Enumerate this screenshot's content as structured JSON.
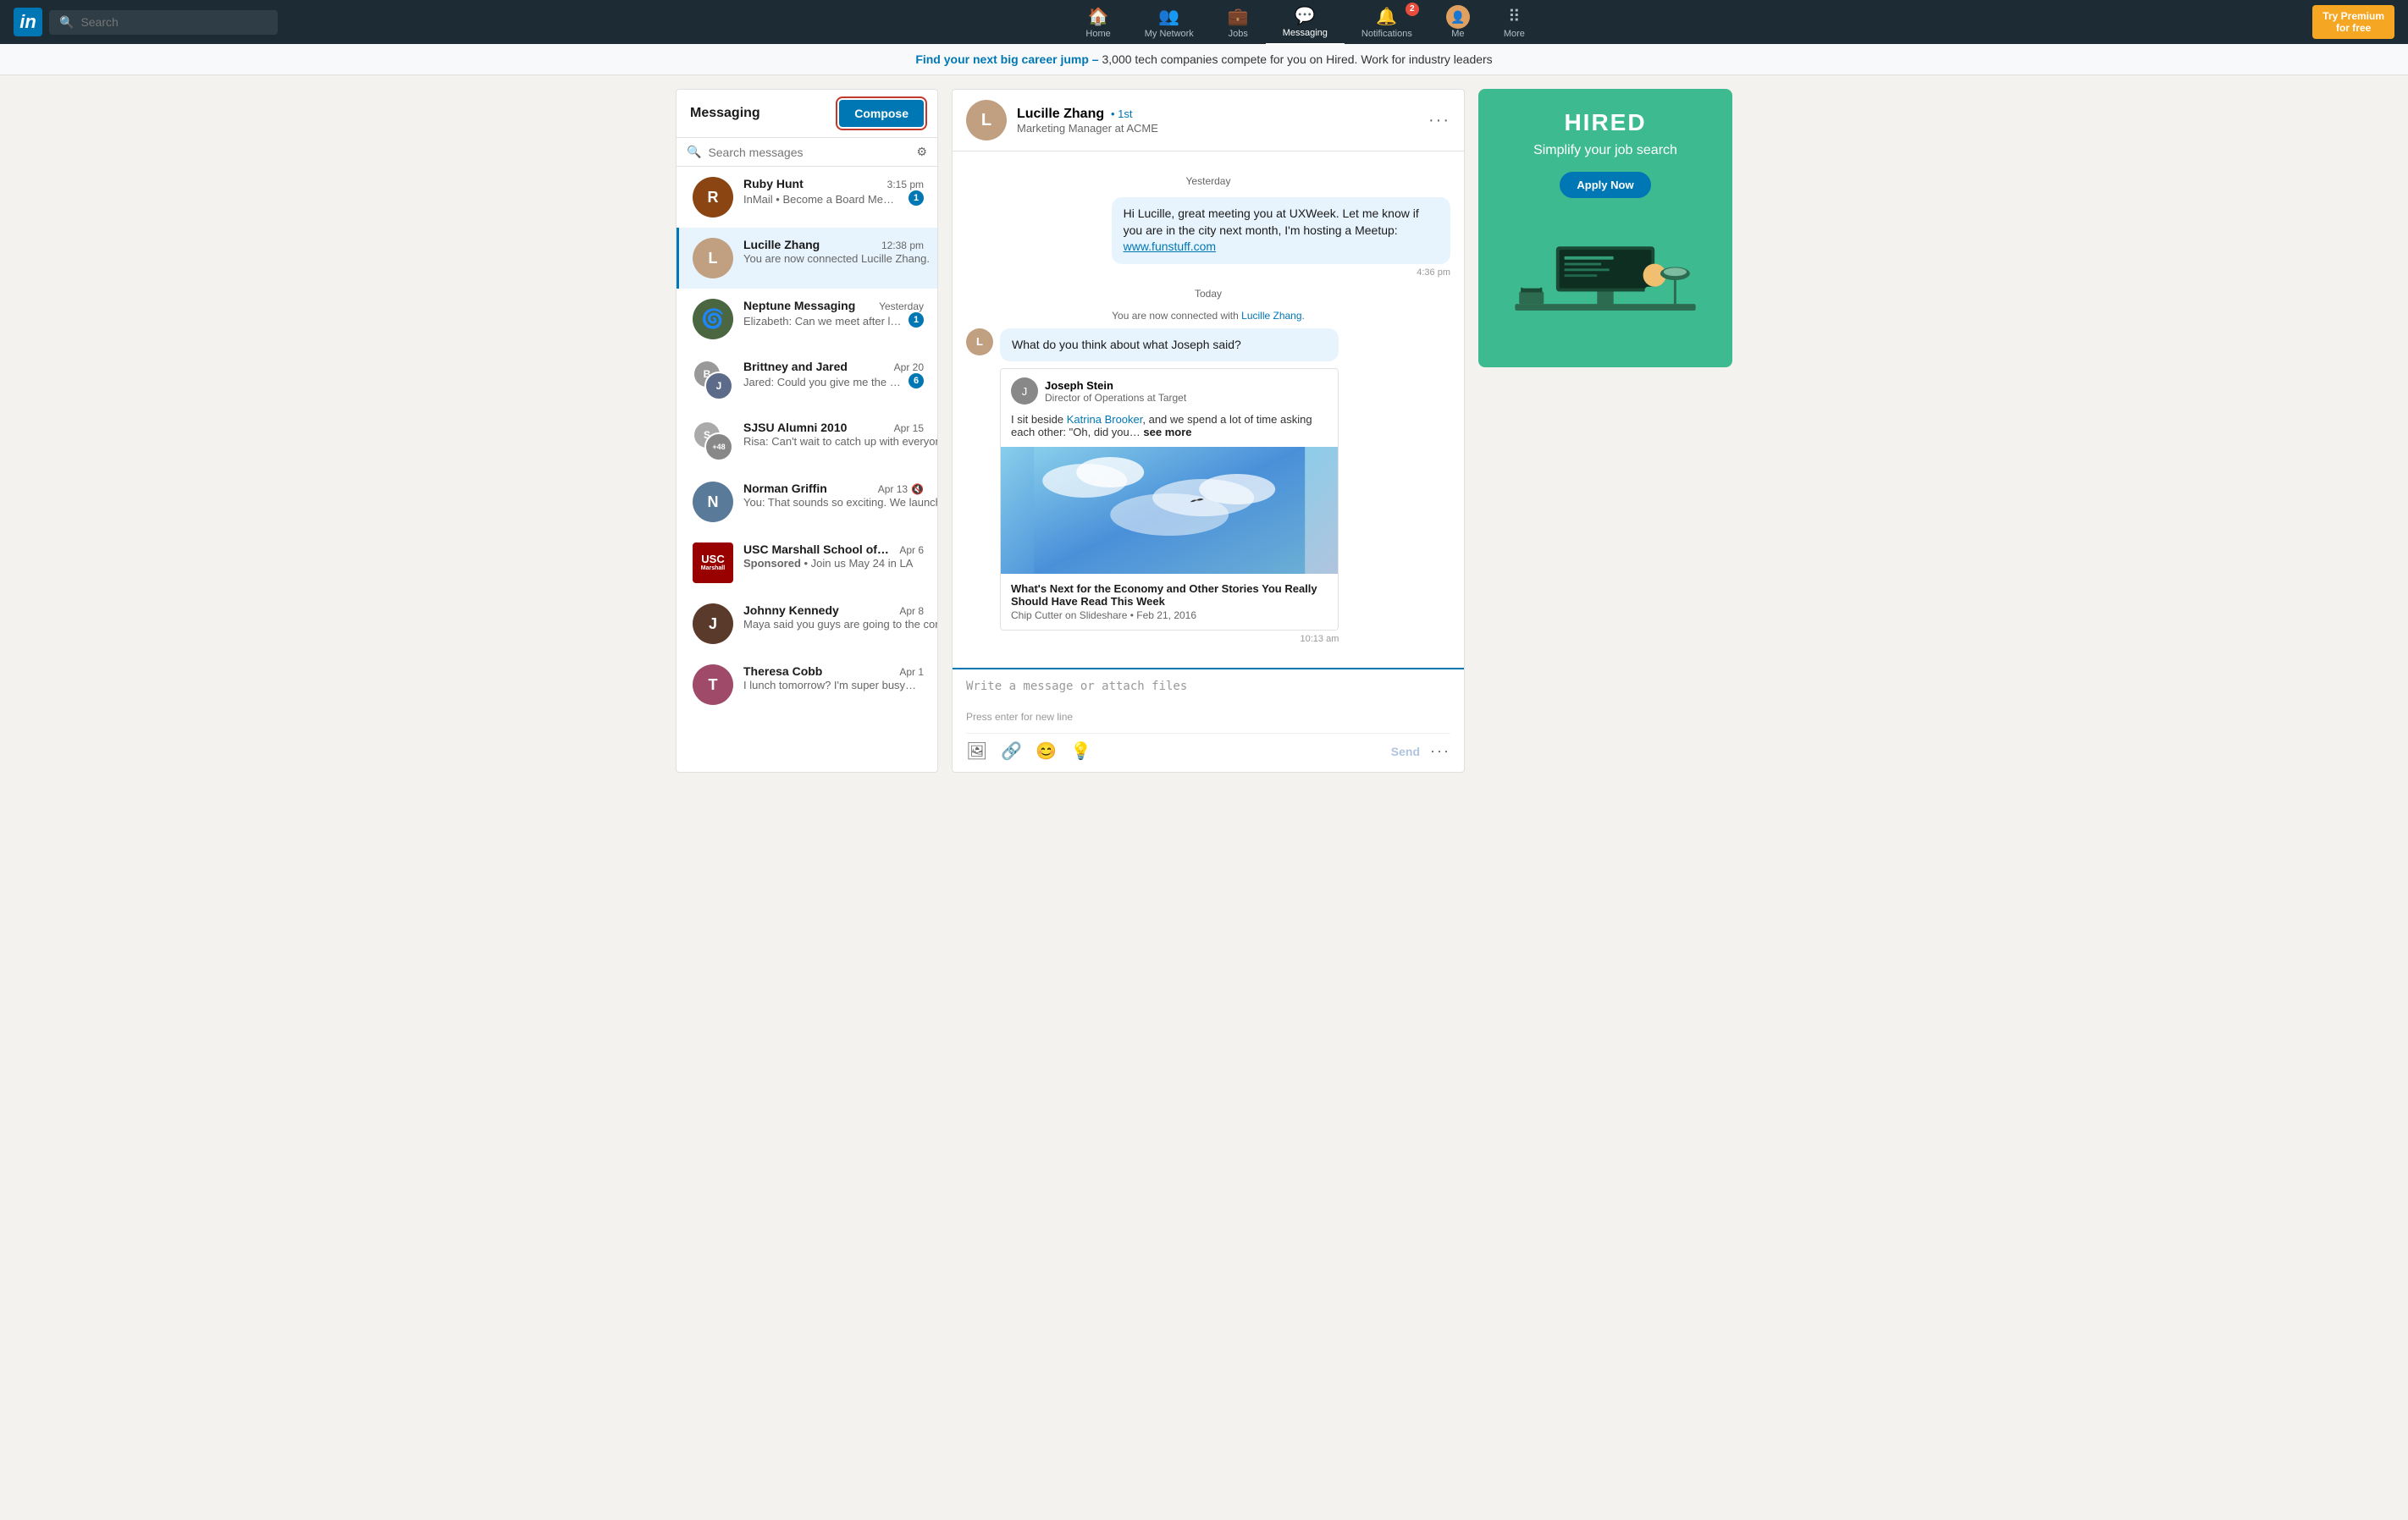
{
  "nav": {
    "logo": "in",
    "search_placeholder": "Search",
    "items": [
      {
        "id": "home",
        "label": "Home",
        "icon": "🏠",
        "active": false,
        "badge": null
      },
      {
        "id": "network",
        "label": "My Network",
        "icon": "👥",
        "active": false,
        "badge": null
      },
      {
        "id": "jobs",
        "label": "Jobs",
        "icon": "💼",
        "active": false,
        "badge": null
      },
      {
        "id": "messaging",
        "label": "Messaging",
        "icon": "💬",
        "active": true,
        "badge": null
      },
      {
        "id": "notifications",
        "label": "Notifications",
        "icon": "🔔",
        "active": false,
        "badge": "2"
      }
    ],
    "me_label": "Me",
    "more_label": "More",
    "premium_label": "Try Premium",
    "premium_sub": "for free"
  },
  "banner": {
    "link_text": "Find your next big career jump –",
    "text": " 3,000 tech companies compete for you on Hired. Work for industry leaders"
  },
  "sidebar": {
    "title": "Messaging",
    "compose_label": "Compose",
    "search_placeholder": "Search messages",
    "conversations": [
      {
        "id": "ruby",
        "name": "Ruby Hunt",
        "time": "3:15 pm",
        "preview": "InMail • Become a Board Member for XYZ System",
        "badge": "1",
        "avatar_letter": "R",
        "avatar_class": "av-ruby"
      },
      {
        "id": "lucille",
        "name": "Lucille Zhang",
        "time": "12:38 pm",
        "preview": "You are now connected Lucille Zhang.",
        "badge": null,
        "avatar_letter": "L",
        "avatar_class": "av-lucille",
        "active": true
      },
      {
        "id": "neptune",
        "name": "Neptune Messaging",
        "time": "Yesterday",
        "preview": "Elizabeth: Can we meet after lunch tomorrow? I'm so swamped…",
        "badge": "1",
        "avatar_letter": "N",
        "avatar_class": "av-neptune"
      },
      {
        "id": "brittney",
        "name": "Brittney and Jared",
        "time": "Apr 20",
        "preview": "Jared: Could you give me the address?",
        "badge": "6",
        "avatar_class": "av-group"
      },
      {
        "id": "sjsu",
        "name": "SJSU Alumni 2010",
        "time": "Apr 15",
        "preview": "Risa: Can't wait to catch up with everyone at the reunion!",
        "badge": null,
        "avatar_class": "av-group-multi",
        "plus": "+48"
      },
      {
        "id": "norman",
        "name": "Norman Griffin",
        "time": "Apr 13",
        "preview": "You: That sounds so exciting. We launched our product recently…",
        "badge": null,
        "avatar_letter": "N",
        "avatar_class": "av-norman",
        "muted": true
      },
      {
        "id": "usc",
        "name": "USC Marshall School of…",
        "time": "Apr 6",
        "preview_sponsored": "Sponsored",
        "preview": " • Join us May 24 in LA",
        "badge": null,
        "is_usc": true
      },
      {
        "id": "johnny",
        "name": "Johnny Kennedy",
        "time": "Apr 8",
        "preview": "Maya said you guys are going to the conference tomorrow. I was…",
        "badge": null,
        "avatar_letter": "J",
        "avatar_class": "av-johnny"
      },
      {
        "id": "theresa",
        "name": "Theresa Cobb",
        "time": "Apr 1",
        "preview": "I lunch tomorrow? I'm super busy…",
        "badge": null,
        "avatar_letter": "T",
        "avatar_class": "av-theresa"
      }
    ]
  },
  "chat": {
    "contact_name": "Lucille Zhang",
    "contact_degree": "• 1st",
    "contact_title": "Marketing Manager at ACME",
    "date_yesterday": "Yesterday",
    "date_today": "Today",
    "connection_status": "You are now connected with",
    "connection_name": "Lucille Zhang",
    "connection_period": ".",
    "messages": [
      {
        "id": "m1",
        "type": "received",
        "text": "Hi Lucille, great meeting you at UXWeek. Let me know if you are in the city next month, I'm hosting a Meetup: www.funstuff.com",
        "time": "4:36 pm",
        "link": "www.funstuff.com"
      },
      {
        "id": "m2",
        "type": "received_question",
        "text": "What do you think about what Joseph said?"
      }
    ],
    "shared_post": {
      "poster_name": "Joseph Stein",
      "poster_title": "Director of Operations at Target",
      "text_before": "I sit beside ",
      "text_link": "Katrina Brooker",
      "text_after": ", and we spend  a lot of time asking each other: \"Oh, did you…",
      "see_more": "see more",
      "post_title": "What's Next for the Economy and Other Stories You Really Should Have Read This Week",
      "post_source": "Chip Cutter on Slideshare",
      "post_date": "Feb 21, 2016",
      "post_time": "10:13 am"
    },
    "input_placeholder": "Write a message or attach files",
    "input_hint": "Press enter for new line",
    "send_label": "Send"
  },
  "ad": {
    "title": "HIRED",
    "subtitle": "Simplify your job search",
    "button_label": "Apply Now"
  }
}
